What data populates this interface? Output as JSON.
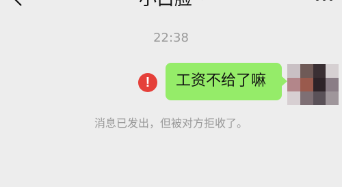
{
  "header": {
    "title": "小白脸"
  },
  "chat": {
    "timestamp": "22:38",
    "messages": [
      {
        "text": "工资不给了嘛",
        "status": "rejected"
      }
    ],
    "system_notice": "消息已发出，但被对方拒收了。"
  },
  "icons": {
    "back": "chevron-left-icon",
    "mute": "bell-muted-icon",
    "more": "more-dots-icon",
    "error": "exclamation-icon",
    "error_glyph": "!"
  },
  "colors": {
    "background": "#ededed",
    "bubble": "#95ec69",
    "error": "#e5403a",
    "muted_text": "#9a9a9a"
  }
}
